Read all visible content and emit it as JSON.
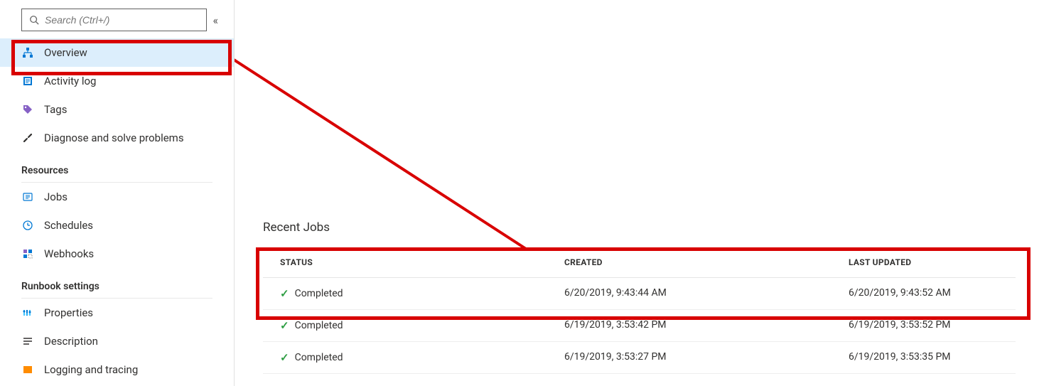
{
  "search": {
    "placeholder": "Search (Ctrl+/)"
  },
  "nav": {
    "overview": "Overview",
    "activity_log": "Activity log",
    "tags": "Tags",
    "diagnose": "Diagnose and solve problems"
  },
  "sections": {
    "resources": "Resources",
    "runbook_settings": "Runbook settings"
  },
  "resources": {
    "jobs": "Jobs",
    "schedules": "Schedules",
    "webhooks": "Webhooks"
  },
  "runbook": {
    "properties": "Properties",
    "description": "Description",
    "logging": "Logging and tracing"
  },
  "main": {
    "recent_jobs": "Recent Jobs",
    "headers": {
      "status": "STATUS",
      "created": "CREATED",
      "updated": "LAST UPDATED"
    },
    "rows": [
      {
        "status": "Completed",
        "created": "6/20/2019, 9:43:44 AM",
        "updated": "6/20/2019, 9:43:52 AM"
      },
      {
        "status": "Completed",
        "created": "6/19/2019, 3:53:42 PM",
        "updated": "6/19/2019, 3:53:52 PM"
      },
      {
        "status": "Completed",
        "created": "6/19/2019, 3:53:27 PM",
        "updated": "6/19/2019, 3:53:35 PM"
      }
    ]
  }
}
